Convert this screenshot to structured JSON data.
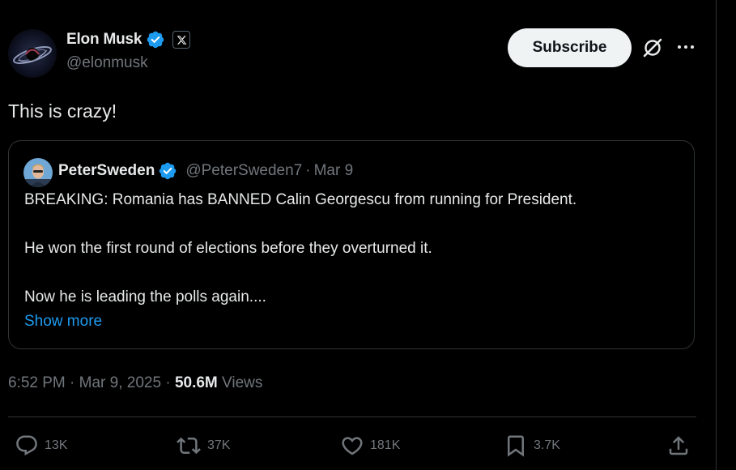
{
  "post": {
    "author_name": "Elon Musk",
    "author_handle": "@elonmusk",
    "subscribe_label": "Subscribe",
    "text": "This is crazy!",
    "time": "6:52 PM",
    "date": "Mar 9, 2025",
    "views_count": "50.6M",
    "views_label": "Views",
    "separator": "·"
  },
  "quote": {
    "author_name": "PeterSweden",
    "author_handle": "@PeterSweden7",
    "separator": "·",
    "date": "Mar 9",
    "lines": [
      "BREAKING: Romania has BANNED Calin Georgescu from running for President.",
      "He won the first round of elections before they overturned it.",
      "Now he is leading the polls again...."
    ],
    "show_more": "Show more"
  },
  "actions": {
    "replies": "13K",
    "reposts": "37K",
    "likes": "181K",
    "bookmarks": "3.7K"
  },
  "icons": {
    "verified": "verified-badge-icon",
    "x_logo": "x-logo-icon",
    "grok": "grok-icon",
    "more": "more-icon",
    "reply": "reply-icon",
    "repost": "repost-icon",
    "like": "like-icon",
    "bookmark": "bookmark-icon",
    "share": "share-icon"
  },
  "colors": {
    "background": "#000000",
    "text_primary": "#e7e9ea",
    "text_secondary": "#71767b",
    "accent": "#1d9bf0",
    "border": "#2f3336",
    "button_bg": "#eff3f4"
  }
}
